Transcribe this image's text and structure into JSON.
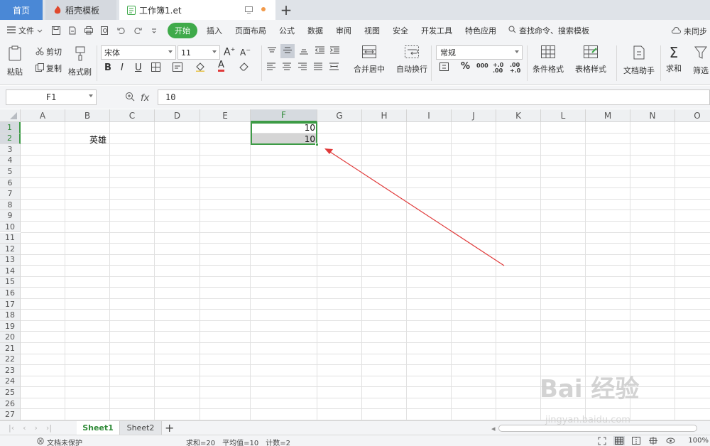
{
  "tabs": {
    "home": "首页",
    "template": "稻壳模板",
    "document": "工作簿1.et"
  },
  "menu": {
    "file": "文件",
    "items": [
      "开始",
      "插入",
      "页面布局",
      "公式",
      "数据",
      "审阅",
      "视图",
      "安全",
      "开发工具",
      "特色应用"
    ],
    "search": "查找命令、搜索模板",
    "sync": "未同步"
  },
  "ribbon": {
    "paste": "粘贴",
    "cut": "剪切",
    "copy": "复制",
    "format_painter": "格式刷",
    "font_name": "宋体",
    "font_size": "11",
    "merge_center": "合并居中",
    "wrap_text": "自动换行",
    "number_format": "常规",
    "conditional_format": "条件格式",
    "table_style": "表格样式",
    "doc_helper": "文档助手",
    "sum": "求和",
    "filter": "筛选",
    "percent": "%",
    "thousands": "000",
    "dec_inc": "+.0 .00",
    "dec_dec": ".00 +.0"
  },
  "formula": {
    "cell_ref": "F1",
    "fx": "fx",
    "value": "10"
  },
  "grid": {
    "columns": [
      "A",
      "B",
      "C",
      "D",
      "E",
      "F",
      "G",
      "H",
      "I",
      "J",
      "K",
      "L",
      "M",
      "N",
      "O"
    ],
    "selected_column": "F",
    "rows": [
      "1",
      "2",
      "3",
      "4",
      "5",
      "6",
      "7",
      "8",
      "9",
      "10",
      "11",
      "12",
      "13",
      "14",
      "15",
      "16",
      "17",
      "18",
      "19",
      "20",
      "21",
      "22",
      "23",
      "24",
      "25",
      "26",
      "27"
    ],
    "cells": {
      "B2": "英雄",
      "F1": "10",
      "F2": "10"
    }
  },
  "sheets": {
    "active": "Sheet1",
    "other": "Sheet2",
    "add": "+"
  },
  "status": {
    "protect": "文档未保护",
    "sum": "求和=20",
    "average": "平均值=10",
    "count": "计数=2",
    "zoom": "100%"
  },
  "colors": {
    "accent": "#3faa4a",
    "home_tab": "#4a88d6",
    "selection": "#3d9b46",
    "annotation": "#e03a3a"
  },
  "watermark": {
    "main": "Bai 经验",
    "sub": "jingyan.baidu.com"
  }
}
